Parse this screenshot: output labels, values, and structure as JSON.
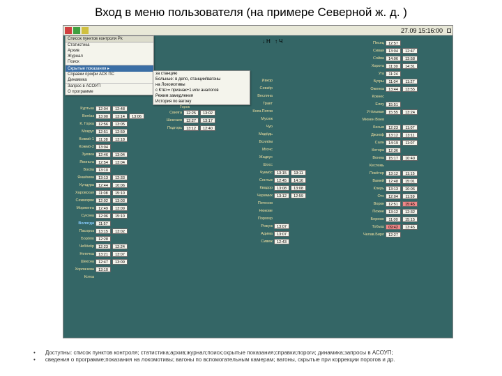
{
  "title": "Вход в меню пользователя (на примере Северной ж. д. )",
  "clock": "27.09 15:16:00",
  "arrow_label": "↓Н   ↑Ч",
  "menu": {
    "title": "Список пунктов контроля         Pk",
    "items": [
      "Статистика",
      "Архив",
      "Журнал",
      "Поиск",
      "Скрытые показания",
      "Справки профи АСК ПС",
      "Динамика",
      "Запрос в АСОУП",
      "О программе"
    ],
    "selected_index": 4,
    "submenu": [
      "за станцию",
      "Больные: в депо, станции/вагоны",
      "на Локомотивы",
      "с Ктв>= признак+1 или аналогов",
      "Режим замедления",
      "История по вагону"
    ]
  },
  "columns": {
    "col1": [
      {
        "name": "Куртыш",
        "t": [
          "12:04",
          "12:48"
        ]
      },
      {
        "name": "Вотќак",
        "t": [
          "13:00",
          "13:14",
          "13:06"
        ]
      },
      {
        "name": "К. Горка",
        "t": [
          "12:56",
          "13:05"
        ]
      },
      {
        "name": "Мокруг",
        "t": [
          "12:51",
          "12:59"
        ]
      },
      {
        "name": "Кожмӧ-1",
        "t": [
          "11:38",
          "13:18"
        ]
      },
      {
        "name": "Кожмӧ-2",
        "t": [
          "13:04"
        ]
      },
      {
        "name": "Зуевка",
        "t": [
          "12:46",
          "13:04"
        ]
      },
      {
        "name": "Явоньта",
        "t": [
          "12:54",
          "13:04"
        ]
      },
      {
        "name": "Вохӧа",
        "t": [
          "13:10"
        ]
      },
      {
        "name": "Якшӧима",
        "t": [
          "13:13",
          "12:33"
        ]
      },
      {
        "name": "Кулдура",
        "t": [
          "12:44",
          "10:06"
        ]
      },
      {
        "name": "Харовская",
        "t": [
          "11:08",
          "15:10"
        ]
      },
      {
        "name": "Сежморве",
        "t": [
          "12:02",
          "13:03"
        ]
      },
      {
        "name": "Морженга",
        "t": [
          "12:49",
          "13:09"
        ]
      },
      {
        "name": "Сухона",
        "t": [
          "12:06",
          "15:10"
        ]
      },
      {
        "name": "Вологда",
        "t": [
          "11:57"
        ],
        "blue": true
      },
      {
        "name": "Пасороз",
        "t": [
          "13:15",
          "13:02"
        ]
      },
      {
        "name": "Борӧпо",
        "t": [
          "12:28"
        ]
      },
      {
        "name": "Чебӧкӧр",
        "t": [
          "12:23",
          "12:24"
        ]
      },
      {
        "name": "Нетечка",
        "t": [
          "13:21",
          "13:07"
        ]
      },
      {
        "name": "Шексна",
        "t": [
          "12:47",
          "13:09"
        ]
      },
      {
        "name": "Хорлачева",
        "t": [
          "13:10"
        ]
      },
      {
        "name": "Котка",
        "t": []
      }
    ],
    "col2_header": "Горок",
    "col2_stations": [
      "Свияга",
      "Шексаев",
      "Подгорь"
    ],
    "col2": [
      {
        "t": [
          "12:25",
          "13:02"
        ]
      },
      {
        "t": [
          "12:27",
          "13:17"
        ]
      },
      {
        "t": [
          "13:12",
          "12:40"
        ]
      }
    ],
    "col3": [
      {
        "name": "Ивкор",
        "t": []
      },
      {
        "name": "Севкӧр",
        "t": []
      },
      {
        "name": "Весляна",
        "t": []
      },
      {
        "name": "Тракт",
        "t": []
      },
      {
        "name": "Кояз.Потов",
        "t": []
      },
      {
        "name": "Мусюк",
        "t": []
      },
      {
        "name": "Чуо",
        "t": []
      },
      {
        "name": "Мадӧдь",
        "t": []
      },
      {
        "name": "Всялӧм",
        "t": []
      },
      {
        "name": "Мгочс",
        "t": []
      },
      {
        "name": "Жадкус",
        "t": []
      },
      {
        "name": "Шосс",
        "t": []
      },
      {
        "name": "Чукмӧс",
        "t": [
          "13:15",
          "13:11"
        ]
      },
      {
        "name": "Сентьж",
        "t": [
          "12:45",
          "14:16"
        ]
      },
      {
        "name": "Квадор",
        "t": [
          "13:08",
          "13:08"
        ]
      },
      {
        "name": "Черемих",
        "t": [
          "13:12",
          "12:59"
        ]
      },
      {
        "name": "Петесов",
        "t": []
      },
      {
        "name": "Нюкове",
        "t": []
      },
      {
        "name": "Порогер",
        "t": []
      },
      {
        "name": "Рожуж",
        "t": [
          "13:07"
        ]
      },
      {
        "name": "Адима",
        "t": [
          "13:07"
        ]
      },
      {
        "name": "Сивеж",
        "t": [
          "12:43"
        ]
      }
    ],
    "col4": [
      {
        "name": "Песец",
        "t": [
          "12:57"
        ]
      },
      {
        "name": "Сивая",
        "t": [
          "13:04",
          "12:47"
        ]
      },
      {
        "name": "Сойва",
        "t": [
          "14:06",
          "13:58"
        ]
      },
      {
        "name": "Хорота",
        "t": [
          "11:30",
          "14:31"
        ]
      },
      {
        "name": "Уга",
        "t": [
          "11:24"
        ]
      },
      {
        "name": "Бугры",
        "t": [
          "11:04",
          "11:27"
        ]
      },
      {
        "name": "Оженка",
        "t": [
          "13:44",
          "13:55"
        ]
      },
      {
        "name": "Кокнес",
        "t": []
      },
      {
        "name": "Елоу",
        "t": [
          "15:51"
        ]
      },
      {
        "name": "Утӧльман",
        "t": [
          "15:55",
          "13:24"
        ]
      },
      {
        "name": "Мюкен Воев",
        "t": []
      },
      {
        "name": "Кесыв",
        "t": [
          "12:23",
          "11:07"
        ]
      },
      {
        "name": "Джэюф",
        "t": [
          "13:12",
          "13:11"
        ]
      },
      {
        "name": "Салн",
        "t": [
          "14:19",
          "11:07"
        ]
      },
      {
        "name": "Котора",
        "t": [
          "12:36"
        ]
      },
      {
        "name": "Вонма",
        "t": [
          "15:17",
          "10:40"
        ]
      },
      {
        "name": "Кестемь",
        "t": []
      },
      {
        "name": "Покӧтер",
        "t": [
          "13:12",
          "11:15"
        ]
      },
      {
        "name": "Вамей",
        "t": [
          "12:48",
          "15:01"
        ]
      },
      {
        "name": "Клерь",
        "t": [
          "13:13",
          "10:06"
        ]
      },
      {
        "name": "Отс",
        "t": [
          "12:04",
          "11:59"
        ]
      },
      {
        "name": "Воркн",
        "t": [
          "12:51",
          "15:45"
        ],
        "red": 2
      },
      {
        "name": "Пожне",
        "t": [
          "13:12",
          "12:32"
        ]
      },
      {
        "name": "Бережн",
        "t": [
          "11:00",
          "15:15"
        ]
      },
      {
        "name": "Тобыш",
        "t": [
          "09:42",
          "13:45"
        ],
        "red": 1
      },
      {
        "name": "Челав.Бирл",
        "t": [
          "12:27"
        ]
      }
    ]
  },
  "footnotes": [
    "Доступны: список пунктов контроля; статистика;архив;журнал;поиск;скрытые показания;справки;пороги; динамика;запросы в АСОУП;",
    "сведения о программе;показания на локомотивы; вагоны по вспомогательным камерам; вагоны, скрытые при коррекции порогов и др."
  ]
}
